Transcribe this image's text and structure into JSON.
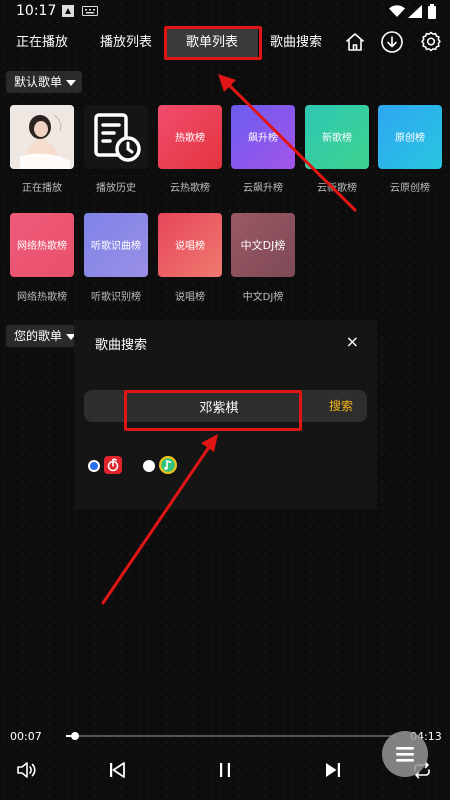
{
  "status_bar": {
    "time": "10:17"
  },
  "nav": {
    "tabs": [
      {
        "label": "正在播放"
      },
      {
        "label": "播放列表"
      },
      {
        "label": "歌单列表",
        "active": true
      },
      {
        "label": "歌曲搜索"
      }
    ],
    "icons": [
      "home-icon",
      "download-icon",
      "settings-icon"
    ]
  },
  "default_playlists": {
    "label": "默认歌单",
    "items": [
      {
        "name": "正在播放",
        "kind": "cover-photo"
      },
      {
        "name": "播放历史",
        "kind": "history-icon"
      },
      {
        "name": "云热歌榜",
        "tile_text": "热歌榜",
        "color_from": "#f24d6f",
        "color_to": "#e3353f"
      },
      {
        "name": "云飙升榜",
        "tile_text": "飙升榜",
        "color_from": "#6a5df0",
        "color_to": "#a454e8"
      },
      {
        "name": "云新歌榜",
        "tile_text": "新歌榜",
        "color_from": "#2ec7b3",
        "color_to": "#3fd38f"
      },
      {
        "name": "云原创榜",
        "tile_text": "原创榜",
        "color_from": "#2fa6f2",
        "color_to": "#28c6e0"
      },
      {
        "name": "网络热歌榜",
        "tile_text": "网络热歌榜",
        "color_from": "#ee5b7a",
        "color_to": "#e8506a"
      },
      {
        "name": "听歌识别榜",
        "tile_text": "听歌识曲榜",
        "color_from": "#7f84e8",
        "color_to": "#9a8fe6"
      },
      {
        "name": "说唱榜",
        "tile_text": "说唱榜",
        "color_from": "#e6455a",
        "color_to": "#f07a70"
      },
      {
        "name": "中文DJ榜",
        "tile_text": "中文DJ榜",
        "color_from": "#9b5866",
        "color_to": "#7d4a55"
      }
    ]
  },
  "your_playlists": {
    "label": "您的歌单"
  },
  "search_dialog": {
    "title": "歌曲搜索",
    "close": "×",
    "input_value": "邓紫棋",
    "search_button": "搜索",
    "sources": [
      {
        "icon": "netease-music-icon",
        "checked": true,
        "color": "#e0262c"
      },
      {
        "icon": "qq-music-icon",
        "checked": false,
        "color": "#f2c418"
      }
    ]
  },
  "player": {
    "elapsed": "00:07",
    "duration": "04:13",
    "progress": 0.028
  }
}
